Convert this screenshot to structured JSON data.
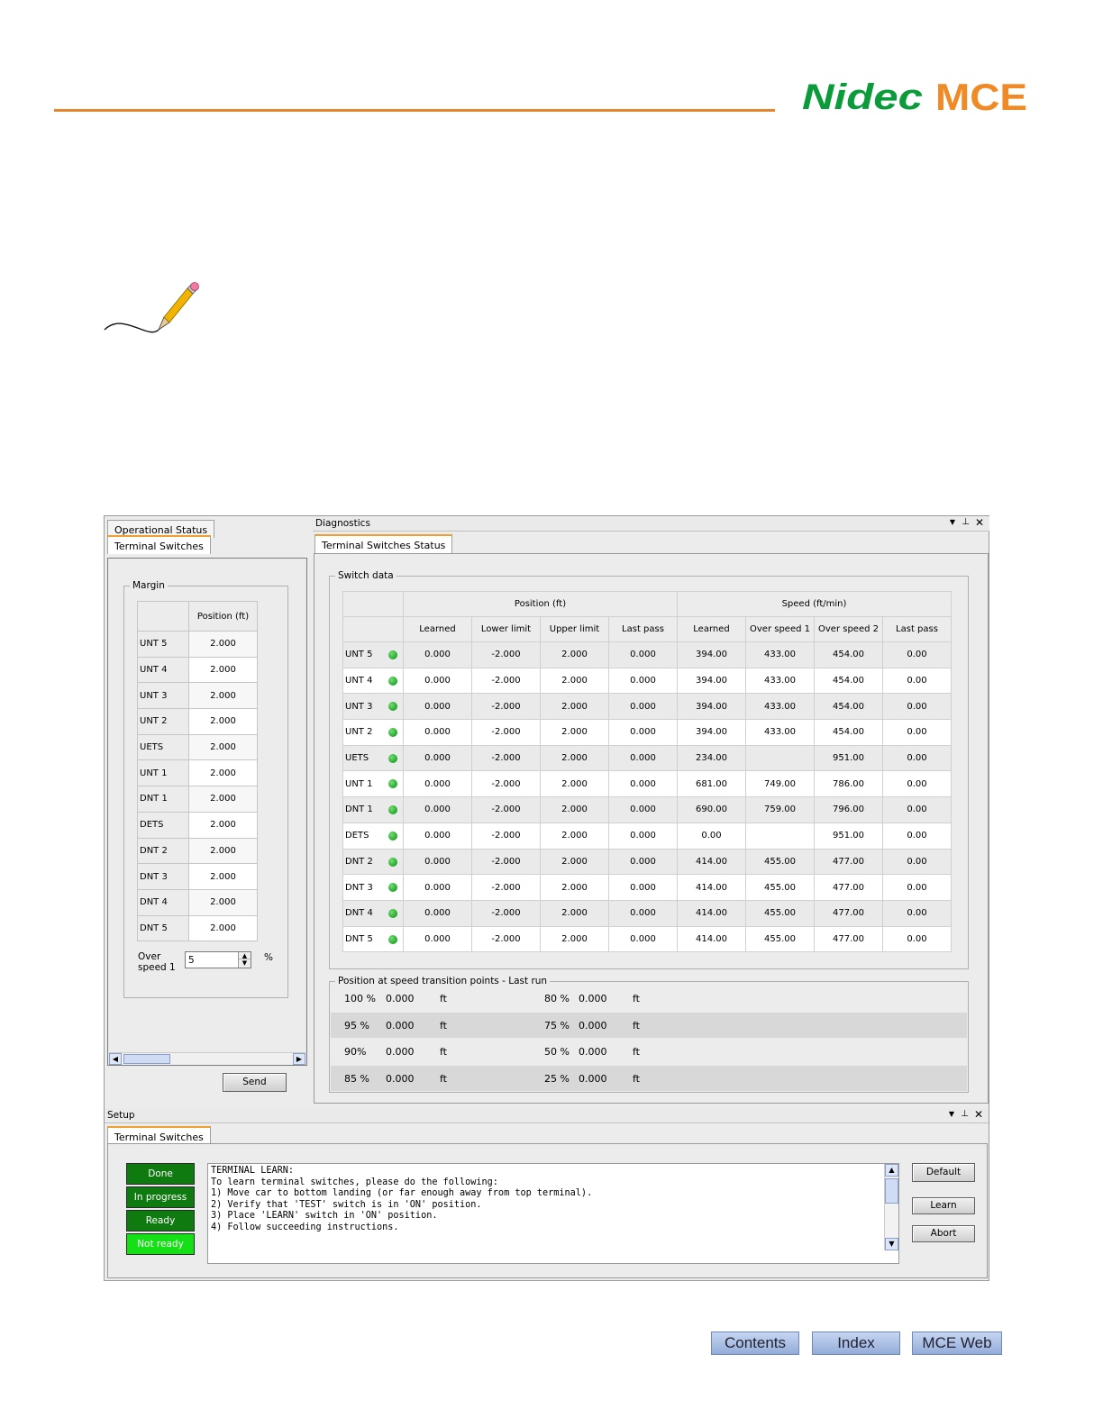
{
  "brand": {
    "nidec": "Nidec",
    "mce": "MCE"
  },
  "left_panel": {
    "tabs": [
      "Operational Status",
      "Terminal Switches"
    ],
    "margin_group_label": "Margin",
    "column_header": "Position (ft)",
    "rows": [
      {
        "label": "UNT 5",
        "value": "2.000"
      },
      {
        "label": "UNT 4",
        "value": "2.000"
      },
      {
        "label": "UNT 3",
        "value": "2.000"
      },
      {
        "label": "UNT 2",
        "value": "2.000"
      },
      {
        "label": "UETS",
        "value": "2.000"
      },
      {
        "label": "UNT 1",
        "value": "2.000"
      },
      {
        "label": "DNT 1",
        "value": "2.000"
      },
      {
        "label": "DETS",
        "value": "2.000"
      },
      {
        "label": "DNT 2",
        "value": "2.000"
      },
      {
        "label": "DNT 3",
        "value": "2.000"
      },
      {
        "label": "DNT 4",
        "value": "2.000"
      },
      {
        "label": "DNT 5",
        "value": "2.000"
      }
    ],
    "overspeed_label_1": "Over",
    "overspeed_label_2": "speed 1",
    "overspeed_value": "5",
    "overspeed_unit": "%",
    "send_label": "Send"
  },
  "diagnostics": {
    "title": "Diagnostics",
    "tab": "Terminal Switches Status",
    "switch_group_label": "Switch data",
    "position_header": "Position (ft)",
    "speed_header": "Speed (ft/min)",
    "subheaders": [
      "Learned",
      "Lower limit",
      "Upper limit",
      "Last pass",
      "Learned",
      "Over speed 1",
      "Over speed 2",
      "Last pass"
    ],
    "rows": [
      {
        "name": "UNT 5",
        "cells": [
          "0.000",
          "-2.000",
          "2.000",
          "0.000",
          "394.00",
          "433.00",
          "454.00",
          "0.00"
        ]
      },
      {
        "name": "UNT 4",
        "cells": [
          "0.000",
          "-2.000",
          "2.000",
          "0.000",
          "394.00",
          "433.00",
          "454.00",
          "0.00"
        ]
      },
      {
        "name": "UNT 3",
        "cells": [
          "0.000",
          "-2.000",
          "2.000",
          "0.000",
          "394.00",
          "433.00",
          "454.00",
          "0.00"
        ]
      },
      {
        "name": "UNT 2",
        "cells": [
          "0.000",
          "-2.000",
          "2.000",
          "0.000",
          "394.00",
          "433.00",
          "454.00",
          "0.00"
        ]
      },
      {
        "name": "UETS",
        "cells": [
          "0.000",
          "-2.000",
          "2.000",
          "0.000",
          "234.00",
          "",
          "951.00",
          "0.00"
        ]
      },
      {
        "name": "UNT 1",
        "cells": [
          "0.000",
          "-2.000",
          "2.000",
          "0.000",
          "681.00",
          "749.00",
          "786.00",
          "0.00"
        ]
      },
      {
        "name": "DNT 1",
        "cells": [
          "0.000",
          "-2.000",
          "2.000",
          "0.000",
          "690.00",
          "759.00",
          "796.00",
          "0.00"
        ]
      },
      {
        "name": "DETS",
        "cells": [
          "0.000",
          "-2.000",
          "2.000",
          "0.000",
          "0.00",
          "",
          "951.00",
          "0.00"
        ]
      },
      {
        "name": "DNT 2",
        "cells": [
          "0.000",
          "-2.000",
          "2.000",
          "0.000",
          "414.00",
          "455.00",
          "477.00",
          "0.00"
        ]
      },
      {
        "name": "DNT 3",
        "cells": [
          "0.000",
          "-2.000",
          "2.000",
          "0.000",
          "414.00",
          "455.00",
          "477.00",
          "0.00"
        ]
      },
      {
        "name": "DNT 4",
        "cells": [
          "0.000",
          "-2.000",
          "2.000",
          "0.000",
          "414.00",
          "455.00",
          "477.00",
          "0.00"
        ]
      },
      {
        "name": "DNT 5",
        "cells": [
          "0.000",
          "-2.000",
          "2.000",
          "0.000",
          "414.00",
          "455.00",
          "477.00",
          "0.00"
        ]
      }
    ],
    "position_group_label": "Position at speed transition points - Last run",
    "transition_rows": [
      {
        "p1": "100 %",
        "v1": "0.000",
        "u1": "ft",
        "p2": "80 %",
        "v2": "0.000",
        "u2": "ft"
      },
      {
        "p1": "95 %",
        "v1": "0.000",
        "u1": "ft",
        "p2": "75 %",
        "v2": "0.000",
        "u2": "ft"
      },
      {
        "p1": "90%",
        "v1": "0.000",
        "u1": "ft",
        "p2": "50 %",
        "v2": "0.000",
        "u2": "ft"
      },
      {
        "p1": "85 %",
        "v1": "0.000",
        "u1": "ft",
        "p2": "25 %",
        "v2": "0.000",
        "u2": "ft"
      }
    ]
  },
  "setup": {
    "title": "Setup",
    "tab": "Terminal Switches",
    "statuses": [
      {
        "label": "Done",
        "color": "#0f7a0f"
      },
      {
        "label": "In progress",
        "color": "#0f7a0f"
      },
      {
        "label": "Ready",
        "color": "#0f7a0f"
      },
      {
        "label": "Not ready",
        "color": "#15e015"
      }
    ],
    "console_lines": [
      "TERMINAL LEARN:",
      "To learn terminal switches, please do the following:",
      "1) Move car to bottom landing (or far enough away from top terminal).",
      "2) Verify that 'TEST' switch is in 'ON' position.",
      "3) Place 'LEARN' switch in 'ON' position.",
      "4) Follow succeeding instructions."
    ],
    "buttons": {
      "default": "Default",
      "learn": "Learn",
      "abort": "Abort"
    }
  },
  "footer": {
    "contents": "Contents",
    "index": "Index",
    "mce_web": "MCE Web"
  }
}
